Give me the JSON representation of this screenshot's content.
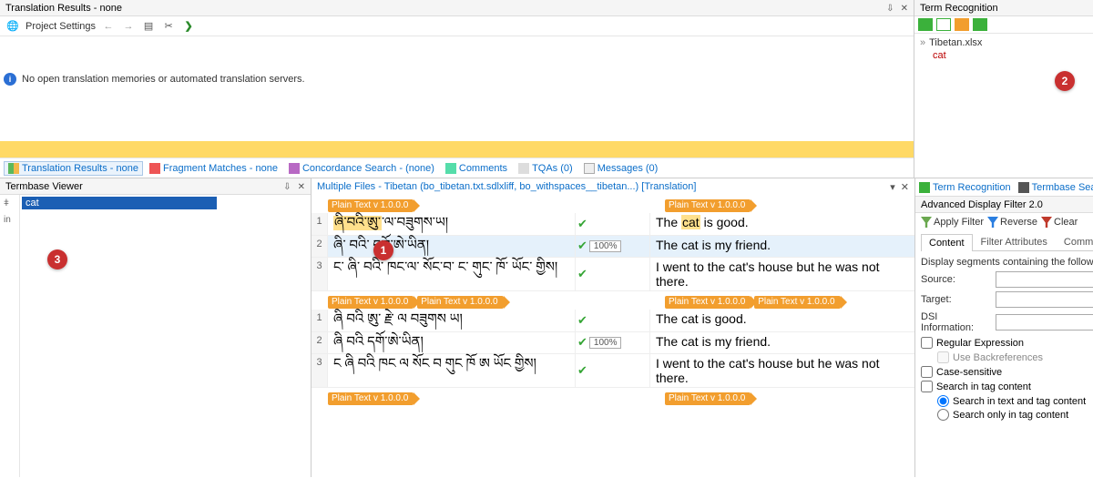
{
  "top_left": {
    "title": "Translation Results - none",
    "proj_settings": "Project Settings",
    "info_msg": "No open translation memories or automated translation servers."
  },
  "bottom_tabs": {
    "tr": "Translation Results - none",
    "fm": "Fragment Matches - none",
    "cs": "Concordance Search - (none)",
    "cm": "Comments",
    "tq": "TQAs (0)",
    "ms": "Messages (0)"
  },
  "term_recog": {
    "title": "Term Recognition",
    "file": "Tibetan.xlsx",
    "word": "cat"
  },
  "tb_viewer": {
    "title": "Termbase Viewer",
    "side1": "ǂ",
    "side2": "in",
    "entry": "cat"
  },
  "editor": {
    "tab_label": "Multiple Files - Tibetan (bo_tibetan.txt.sdlxliff, bo_withspaces__tibetan...) [Translation]",
    "file_tag": "Plain Text v 1.0.0.0",
    "match100": "100%",
    "rows1": [
      {
        "n": "1",
        "src": "ཞི་བའི་ཨུ་",
        "src2": "ཞི་བའི་ཨུ་",
        "src_tail": "་ལ་བཟུགས་ཡ།",
        "tgt_pre": "The ",
        "tgt_term": "cat",
        "tgt_post": " is good."
      },
      {
        "n": "2",
        "src": "ཞི་ བའི་ དགོ་ཨེ་ཡིན།",
        "tgt": "The cat is my friend.",
        "match": true,
        "sel": true
      },
      {
        "n": "3",
        "src": "ང་ ཞི་ བའི་ ཁང་ལ་ སོང་བ་ ང་ གུང་ ཁོ་ ཡོང་ གྱིས།",
        "tgt": "I went to the cat's house but he was not there."
      }
    ],
    "rows2": [
      {
        "n": "1",
        "src": "ཞི བའི ཨུ་ རྗེ་ ལ བཟུགས ཡ།",
        "tgt": "The cat is good."
      },
      {
        "n": "2",
        "src": "ཞི བའི དགོ་ཨེ་ཡིན།",
        "tgt": "The cat is my friend.",
        "match": true
      },
      {
        "n": "3",
        "src": "ང ཞི བའི ཁང ལ སོང བ གུང ཁོ ཨ ཡོང གྱིས།",
        "tgt": "I went to the cat's house but he was not there."
      }
    ]
  },
  "right_tabs": {
    "tr": "Term Recognition",
    "ts": "Termbase Search"
  },
  "adf": {
    "title": "Advanced Display Filter 2.0",
    "apply": "Apply Filter",
    "reverse": "Reverse",
    "clear": "Clear",
    "sub_content": "Content",
    "sub_filter": "Filter Attributes",
    "sub_comments": "Comments",
    "desc": "Display segments containing the following",
    "source_lbl": "Source:",
    "target_lbl": "Target:",
    "dsi_lbl": "DSI Information:",
    "regex": "Regular Expression",
    "backref": "Use Backreferences",
    "casesens": "Case-sensitive",
    "searchtag": "Search in tag content",
    "rb_textandtag": "Search in text and tag content",
    "rb_onlytag": "Search only in tag content"
  },
  "annot": {
    "b1": "1",
    "b2": "2",
    "b3": "3"
  }
}
